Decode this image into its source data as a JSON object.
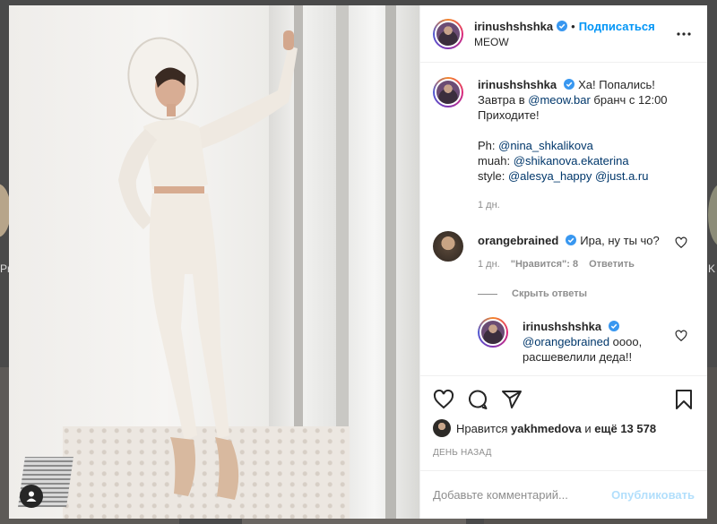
{
  "post": {
    "author": "irinushshshka",
    "location": "MEOW",
    "follow_label": "Подписаться",
    "caption": {
      "l1_text": "Ха! Попались!",
      "l2_a": "Завтра в ",
      "l2_mention": "@meow.bar",
      "l2_b": " бранч с 12:00",
      "l3": "Приходите!",
      "ph_label": "Ph: ",
      "ph_mention": "@nina_shkalikova",
      "muah_label": "muah: ",
      "muah_mention": "@shikanova.ekaterina",
      "style_label": "style: ",
      "style_mention1": "@alesya_happy",
      "style_mention2": "@just.a.ru",
      "time": "1 дн."
    },
    "comments": [
      {
        "author": "orangebrained",
        "text": "Ира, ну ты чо?",
        "time": "1 дн.",
        "likes": "\"Нравится\": 8",
        "reply_label": "Ответить"
      }
    ],
    "hide_replies_label": "Скрыть ответы",
    "reply": {
      "author": "irinushshshka",
      "mention": "@orangebrained",
      "text_a": " оооо,",
      "text_b": "расшевелили деда!!"
    },
    "likes_prefix": "Нравится",
    "likes_user": "yakhmedova",
    "likes_mid": "и",
    "likes_count": "ещё 13 578",
    "posted": "ДЕНЬ НАЗАД",
    "comment_placeholder": "Добавьте комментарий...",
    "publish_label": "Опубликовать"
  },
  "background": {
    "left_text": "Pro",
    "right_text": "K"
  },
  "colors": {
    "link": "#0095f6",
    "mention": "#00376b",
    "muted": "#8e8e8e",
    "publish_disabled": "#b2dffc"
  },
  "icons": [
    "heart-icon",
    "comment-icon",
    "share-icon",
    "bookmark-icon",
    "more-icon",
    "verified-icon",
    "user-tag-icon"
  ]
}
